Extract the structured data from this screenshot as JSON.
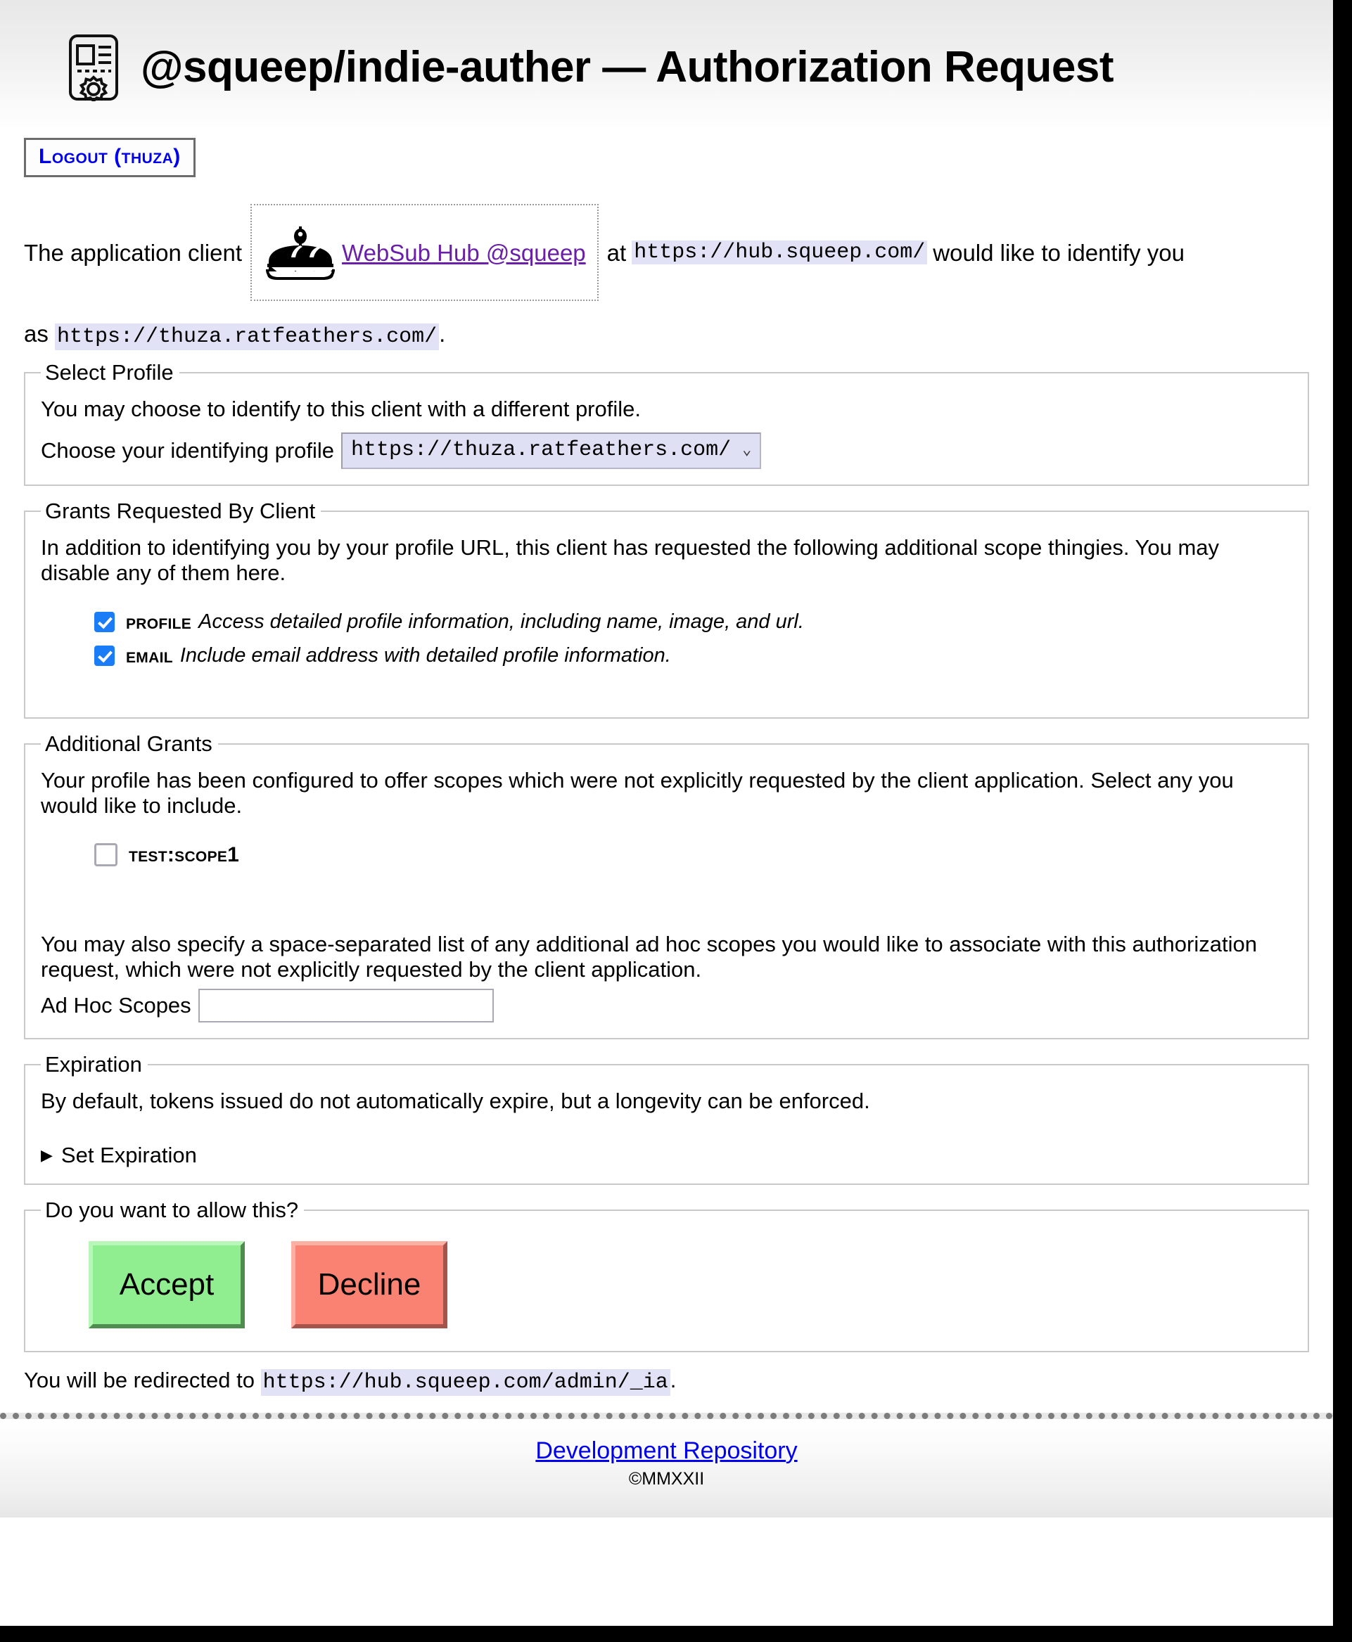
{
  "header": {
    "icon": "authorization-card-gear-icon",
    "title": "@squeep/indie-auther — Authorization Request"
  },
  "logout": {
    "label": "Logout (thuza)"
  },
  "intro": {
    "prefix": "The application client",
    "client_logo_icon": "sandwich-icon",
    "client_name": "WebSub Hub @squeep",
    "at": "at",
    "client_url": "https://hub.squeep.com/",
    "suffix": "would like to identify you",
    "as_prefix": "as",
    "profile_url": "https://thuza.ratfeathers.com/",
    "as_suffix": "."
  },
  "select_profile": {
    "legend": "Select Profile",
    "description": "You may choose to identify to this client with a different profile.",
    "label": "Choose your identifying profile",
    "selected_value": "https://thuza.ratfeathers.com/",
    "chevron": "⌄"
  },
  "grants_requested": {
    "legend": "Grants Requested By Client",
    "description": "In addition to identifying you by your profile URL, this client has requested the following additional scope thingies. You may disable any of them here.",
    "scopes": [
      {
        "name": "profile",
        "description": "Access detailed profile information, including name, image, and url.",
        "checked": true
      },
      {
        "name": "email",
        "description": "Include email address with detailed profile information.",
        "checked": true
      }
    ]
  },
  "additional_grants": {
    "legend": "Additional Grants",
    "description": "Your profile has been configured to offer scopes which were not explicitly requested by the client application. Select any you would like to include.",
    "scopes": [
      {
        "name": "test:scope1",
        "description": "",
        "checked": false
      }
    ],
    "adhoc_note": "You may also specify a space-separated list of any additional ad hoc scopes you would like to associate with this authorization request, which were not explicitly requested by the client application.",
    "adhoc_label": "Ad Hoc Scopes",
    "adhoc_value": "",
    "adhoc_placeholder": ""
  },
  "expiration": {
    "legend": "Expiration",
    "description": "By default, tokens issued do not automatically expire, but a longevity can be enforced.",
    "summary_marker": "▶",
    "summary_label": "Set Expiration"
  },
  "decision": {
    "legend": "Do you want to allow this?",
    "accept_label": "Accept",
    "decline_label": "Decline",
    "accept_color": "#90ee90",
    "decline_color": "#f98272"
  },
  "redirect": {
    "prefix": "You will be redirected to",
    "url": "https://hub.squeep.com/admin/_ia",
    "suffix": "."
  },
  "footer": {
    "link_label": "Development Repository",
    "copyright": "©MMXXII"
  }
}
